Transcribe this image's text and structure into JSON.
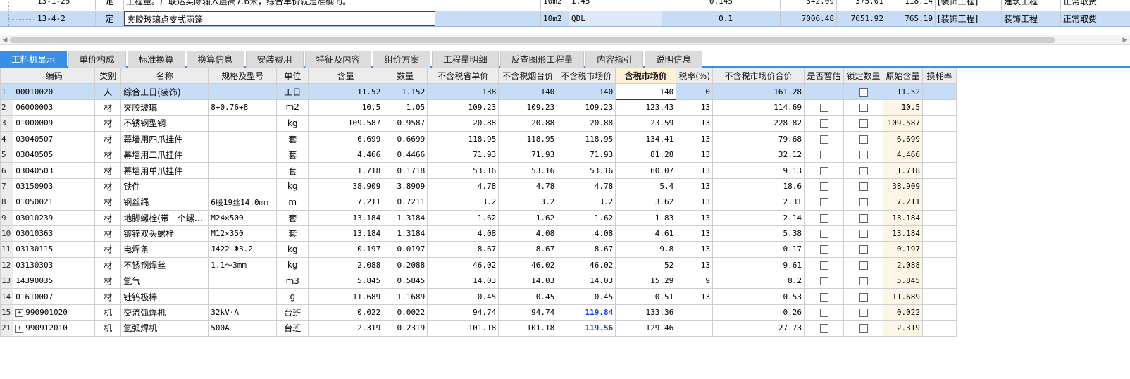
{
  "upper": {
    "row1": {
      "code": "13-1-25",
      "type": "定",
      "name": "工程量。广联达实际输入层高7.6米，综合单价就是准确的。",
      "unit": "10m2",
      "qty": "1.45",
      "q2": "0.145",
      "p1": "342.09",
      "p2": "375.01",
      "p3": "118.14",
      "major": "[装饰工程]",
      "category": "建筑工程",
      "fee": "正常取费"
    },
    "row2": {
      "code": "13-4-2",
      "type": "定",
      "name": "夹胶玻璃点支式雨篷",
      "unit": "10m2",
      "qty": "QDL",
      "q2": "0.1",
      "p1": "7006.48",
      "p2": "7651.92",
      "p3": "765.19",
      "major": "[装饰工程]",
      "category": "装饰工程",
      "fee": "正常取费"
    }
  },
  "tabs": [
    "工料机显示",
    "单价构成",
    "标准换算",
    "换算信息",
    "安装费用",
    "特征及内容",
    "组价方案",
    "工程量明细",
    "反查图形工程量",
    "内容指引",
    "说明信息"
  ],
  "columns": [
    "编码",
    "类别",
    "名称",
    "规格及型号",
    "单位",
    "含量",
    "数量",
    "不含税省单价",
    "不含税烟台价",
    "不含税市场价",
    "含税市场价",
    "税率(%)",
    "不含税市场价合价",
    "是否暂估",
    "锁定数量",
    "原始含量",
    "损耗率"
  ],
  "rows": [
    {
      "idx": "1",
      "code": "00010020",
      "type": "人",
      "name": "综合工日(装饰)",
      "spec": "",
      "unit": "工日",
      "content": "11.52",
      "qty": "1.152",
      "p_prov": "138",
      "p_yt": "140",
      "p_mkt": "140",
      "p_tax": "140",
      "rate": "0",
      "total": "161.28",
      "orig": "11.52"
    },
    {
      "idx": "2",
      "code": "06000003",
      "type": "材",
      "name": "夹胶玻璃",
      "spec": "8+0.76+8",
      "unit": "m2",
      "content": "10.5",
      "qty": "1.05",
      "p_prov": "109.23",
      "p_yt": "109.23",
      "p_mkt": "109.23",
      "p_tax": "123.43",
      "rate": "13",
      "total": "114.69",
      "orig": "10.5"
    },
    {
      "idx": "3",
      "code": "01000009",
      "type": "材",
      "name": "不锈钢型钢",
      "spec": "",
      "unit": "kg",
      "content": "109.587",
      "qty": "10.9587",
      "p_prov": "20.88",
      "p_yt": "20.88",
      "p_mkt": "20.88",
      "p_tax": "23.59",
      "rate": "13",
      "total": "228.82",
      "orig": "109.587"
    },
    {
      "idx": "4",
      "code": "03040507",
      "type": "材",
      "name": "幕墙用四爪挂件",
      "spec": "",
      "unit": "套",
      "content": "6.699",
      "qty": "0.6699",
      "p_prov": "118.95",
      "p_yt": "118.95",
      "p_mkt": "118.95",
      "p_tax": "134.41",
      "rate": "13",
      "total": "79.68",
      "orig": "6.699"
    },
    {
      "idx": "5",
      "code": "03040505",
      "type": "材",
      "name": "幕墙用二爪挂件",
      "spec": "",
      "unit": "套",
      "content": "4.466",
      "qty": "0.4466",
      "p_prov": "71.93",
      "p_yt": "71.93",
      "p_mkt": "71.93",
      "p_tax": "81.28",
      "rate": "13",
      "total": "32.12",
      "orig": "4.466"
    },
    {
      "idx": "6",
      "code": "03040503",
      "type": "材",
      "name": "幕墙用单爪挂件",
      "spec": "",
      "unit": "套",
      "content": "1.718",
      "qty": "0.1718",
      "p_prov": "53.16",
      "p_yt": "53.16",
      "p_mkt": "53.16",
      "p_tax": "60.07",
      "rate": "13",
      "total": "9.13",
      "orig": "1.718"
    },
    {
      "idx": "7",
      "code": "03150903",
      "type": "材",
      "name": "铁件",
      "spec": "",
      "unit": "kg",
      "content": "38.909",
      "qty": "3.8909",
      "p_prov": "4.78",
      "p_yt": "4.78",
      "p_mkt": "4.78",
      "p_tax": "5.4",
      "rate": "13",
      "total": "18.6",
      "orig": "38.909"
    },
    {
      "idx": "8",
      "code": "01050021",
      "type": "材",
      "name": "钢丝绳",
      "spec": "6股19丝14.0mm",
      "unit": "m",
      "content": "7.211",
      "qty": "0.7211",
      "p_prov": "3.2",
      "p_yt": "3.2",
      "p_mkt": "3.2",
      "p_tax": "3.62",
      "rate": "13",
      "total": "2.31",
      "orig": "7.211"
    },
    {
      "idx": "9",
      "code": "03010239",
      "type": "材",
      "name": "地脚螺栓(带一个螺…",
      "spec": "M24×500",
      "unit": "套",
      "content": "13.184",
      "qty": "1.3184",
      "p_prov": "1.62",
      "p_yt": "1.62",
      "p_mkt": "1.62",
      "p_tax": "1.83",
      "rate": "13",
      "total": "2.14",
      "orig": "13.184"
    },
    {
      "idx": "10",
      "code": "03010363",
      "type": "材",
      "name": "镀锌双头螺栓",
      "spec": "M12×350",
      "unit": "套",
      "content": "13.184",
      "qty": "1.3184",
      "p_prov": "4.08",
      "p_yt": "4.08",
      "p_mkt": "4.08",
      "p_tax": "4.61",
      "rate": "13",
      "total": "5.38",
      "orig": "13.184"
    },
    {
      "idx": "11",
      "code": "03130115",
      "type": "材",
      "name": "电焊条",
      "spec": "J422 Φ3.2",
      "unit": "kg",
      "content": "0.197",
      "qty": "0.0197",
      "p_prov": "8.67",
      "p_yt": "8.67",
      "p_mkt": "8.67",
      "p_tax": "9.8",
      "rate": "13",
      "total": "0.17",
      "orig": "0.197"
    },
    {
      "idx": "12",
      "code": "03130303",
      "type": "材",
      "name": "不锈钢焊丝",
      "spec": "1.1～3mm",
      "unit": "kg",
      "content": "2.088",
      "qty": "0.2088",
      "p_prov": "46.02",
      "p_yt": "46.02",
      "p_mkt": "46.02",
      "p_tax": "52",
      "rate": "13",
      "total": "9.61",
      "orig": "2.088"
    },
    {
      "idx": "13",
      "code": "14390035",
      "type": "材",
      "name": "氩气",
      "spec": "",
      "unit": "m3",
      "content": "5.845",
      "qty": "0.5845",
      "p_prov": "14.03",
      "p_yt": "14.03",
      "p_mkt": "14.03",
      "p_tax": "15.29",
      "rate": "9",
      "total": "8.2",
      "orig": "5.845"
    },
    {
      "idx": "14",
      "code": "01610007",
      "type": "材",
      "name": "钍钨极棒",
      "spec": "",
      "unit": "g",
      "content": "11.689",
      "qty": "1.1689",
      "p_prov": "0.45",
      "p_yt": "0.45",
      "p_mkt": "0.45",
      "p_tax": "0.51",
      "rate": "13",
      "total": "0.53",
      "orig": "11.689"
    },
    {
      "idx": "15",
      "code": "990901020",
      "type": "机",
      "name": "交流弧焊机",
      "spec": "32kV·A",
      "unit": "台班",
      "content": "0.022",
      "qty": "0.0022",
      "p_prov": "94.74",
      "p_yt": "94.74",
      "p_mkt": "119.84",
      "p_tax": "133.36",
      "rate": "",
      "total": "0.26",
      "orig": "0.022",
      "expand": true
    },
    {
      "idx": "21",
      "code": "990912010",
      "type": "机",
      "name": "氩弧焊机",
      "spec": "500A",
      "unit": "台班",
      "content": "2.319",
      "qty": "0.2319",
      "p_prov": "101.18",
      "p_yt": "101.18",
      "p_mkt": "119.56",
      "p_tax": "129.46",
      "rate": "",
      "total": "27.73",
      "orig": "2.319",
      "expand": true
    }
  ],
  "expand_symbol": "+",
  "colors": {
    "selected": "#c7dcf6",
    "tab_active": "#3a8ee6",
    "override_price": "#1144dd"
  }
}
